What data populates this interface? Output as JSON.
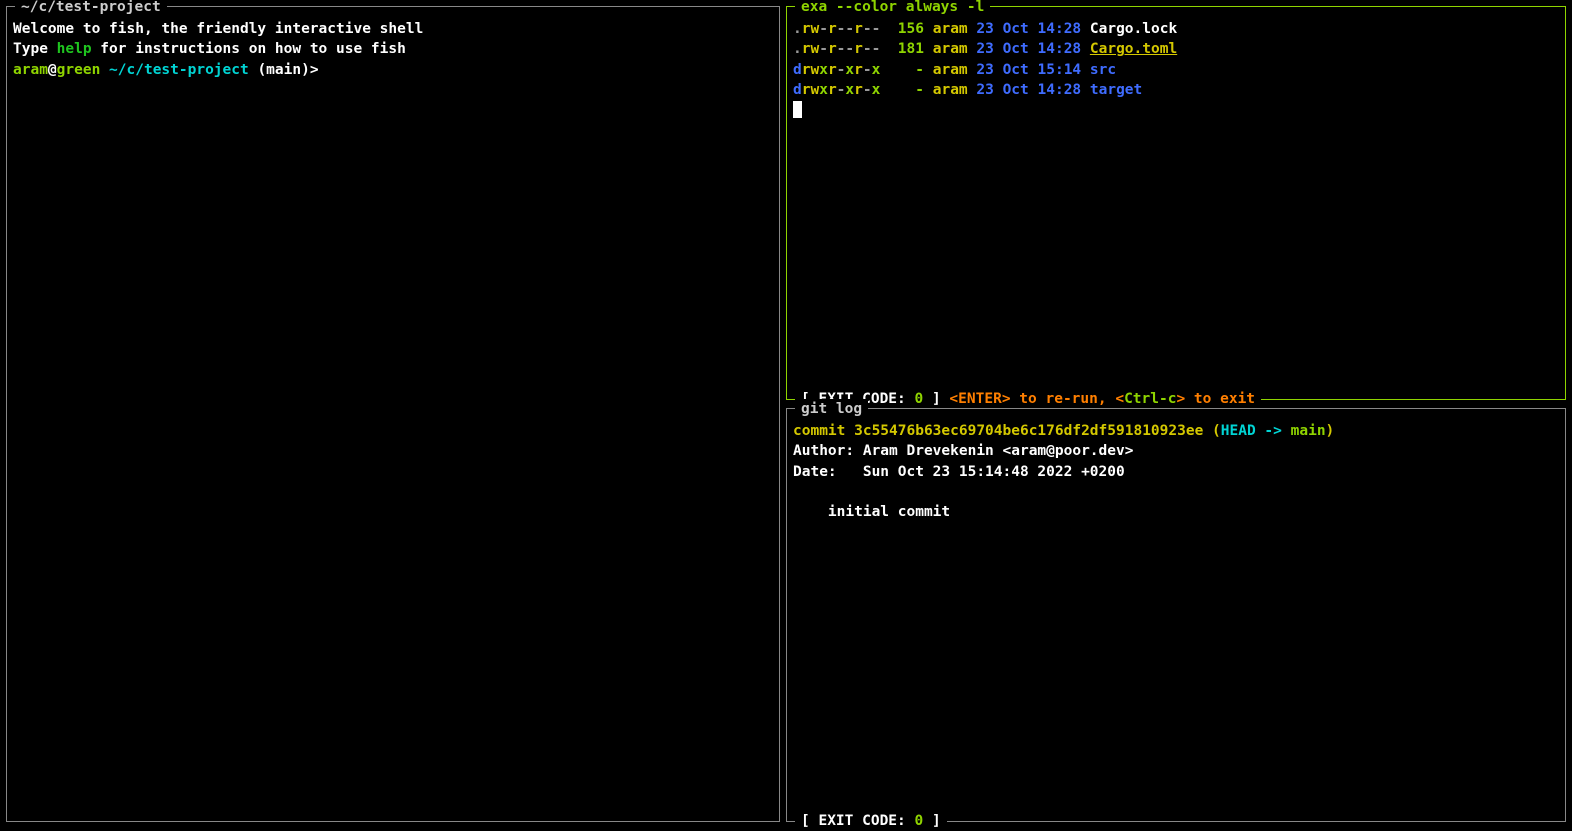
{
  "leftPane": {
    "title": " ~/c/test-project ",
    "welcome1": "Welcome to fish, the friendly interactive shell",
    "welcome2a": "Type ",
    "welcome2b": "help",
    "welcome2c": " for instructions on how to use fish",
    "prompt_user": "aram",
    "prompt_at": "@",
    "prompt_host": "green",
    "prompt_path": " ~/c/test-project",
    "prompt_branch": " (main)",
    "prompt_end": ">"
  },
  "topRightPane": {
    "title": " exa --color always -l ",
    "rows": [
      {
        "perm_pre": ".",
        "perm_rw": "rw",
        "perm_dash1": "-",
        "perm_r1": "r",
        "perm_dash2": "--",
        "perm_r2": "r",
        "perm_dash3": "--",
        "size": "156",
        "user": "aram",
        "date": "23 Oct 14:28",
        "name": "Cargo.lock",
        "name_class": "c-white",
        "underline": false,
        "is_dir": false
      },
      {
        "perm_pre": ".",
        "perm_rw": "rw",
        "perm_dash1": "-",
        "perm_r1": "r",
        "perm_dash2": "--",
        "perm_r2": "r",
        "perm_dash3": "--",
        "size": "181",
        "user": "aram",
        "date": "23 Oct 14:28",
        "name": "Cargo.toml",
        "name_class": "c-yellow",
        "underline": true,
        "is_dir": false
      },
      {
        "perm_d": "d",
        "perm_rw": "rw",
        "perm_x1": "x",
        "perm_r1": "r",
        "perm_dash": "-",
        "perm_x2": "x",
        "perm_r2": "r",
        "perm_dash2": "-",
        "perm_x3": "x",
        "size": "-",
        "user": "aram",
        "date": "23 Oct 15:14",
        "name": "src",
        "name_class": "c-blue",
        "underline": false,
        "is_dir": true
      },
      {
        "perm_d": "d",
        "perm_rw": "rw",
        "perm_x1": "x",
        "perm_r1": "r",
        "perm_dash": "-",
        "perm_x2": "x",
        "perm_r2": "r",
        "perm_dash2": "-",
        "perm_x3": "x",
        "size": "-",
        "user": "aram",
        "date": "23 Oct 14:28",
        "name": "target",
        "name_class": "c-blue",
        "underline": false,
        "is_dir": true
      }
    ],
    "footer": {
      "bracket_open": "[ ",
      "exit_label": "EXIT CODE: ",
      "exit_code": "0",
      "bracket_close": " ]",
      "enter_open": " <",
      "enter": "ENTER",
      "enter_close": ">",
      "rerun": " to re-run, ",
      "ctrlc_open": "<",
      "ctrlc": "Ctrl-c",
      "ctrlc_close": ">",
      "exit": " to exit "
    }
  },
  "bottomRightPane": {
    "title": " git log ",
    "commit_label": "commit ",
    "commit_hash": "3c55476b63ec69704be6c176df2df591810923ee",
    "head_open": " (",
    "head": "HEAD -> ",
    "head_branch": "main",
    "head_close": ")",
    "author": "Author: Aram Drevekenin <aram@poor.dev>",
    "date": "Date:   Sun Oct 23 15:14:48 2022 +0200",
    "message": "    initial commit",
    "footer_open": "[ ",
    "footer_label": "EXIT CODE: ",
    "footer_code": "0",
    "footer_close": " ]"
  }
}
